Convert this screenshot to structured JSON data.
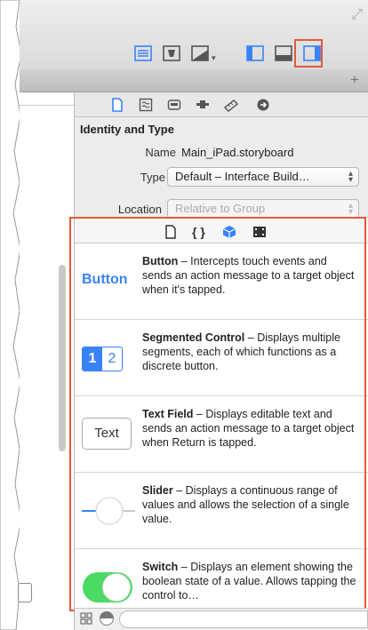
{
  "colors": {
    "accent": "#3a82f7",
    "highlight": "#e05a3a",
    "switch_on": "#4cd964"
  },
  "identity": {
    "section_title": "Identity and Type",
    "name_label": "Name",
    "name_value": "Main_iPad.storyboard",
    "type_label": "Type",
    "type_value": "Default – Interface Build…",
    "location_label": "Location",
    "location_value": "Relative to Group"
  },
  "library": {
    "items": [
      {
        "title": "Button",
        "desc": " – Intercepts touch events and sends an action message to a target object when it's tapped.",
        "thumb": "Button"
      },
      {
        "title": "Segmented Control",
        "desc": " – Displays multiple segments, each of which functions as a discrete button.",
        "thumb_a": "1",
        "thumb_b": "2"
      },
      {
        "title": "Text Field",
        "desc": " – Displays editable text and sends an action message to a target object when Return is tapped.",
        "thumb": "Text"
      },
      {
        "title": "Slider",
        "desc": " – Displays a continuous range of values and allows the selection of a single value."
      },
      {
        "title": "Switch",
        "desc": " – Displays an element showing the boolean state of a value. Allows tapping the control to…"
      }
    ]
  }
}
